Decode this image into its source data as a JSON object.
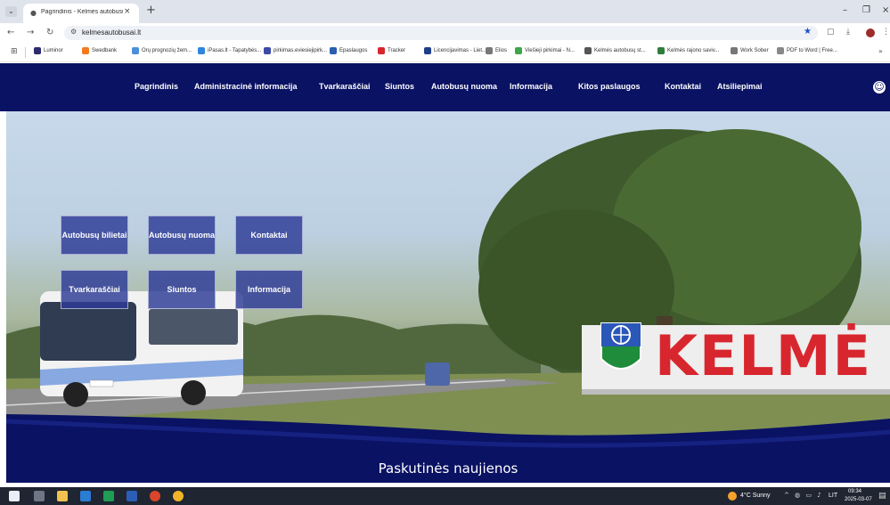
{
  "browser": {
    "tab_title": "Pagrindinis - Kelmės autobusų",
    "url": "kelmesautobusai.lt",
    "bookmarks": [
      {
        "label": "Luminor",
        "color": "#2b2b6e"
      },
      {
        "label": "Swedbank",
        "color": "#f47b20"
      },
      {
        "label": "Orų prognozių žem...",
        "color": "#4a8fd8"
      },
      {
        "label": "iPasas.lt - Tapatybės...",
        "color": "#2e86de"
      },
      {
        "label": "pirkimas.eviesiejipirk...",
        "color": "#3b4aa8"
      },
      {
        "label": "Epaslaugos",
        "color": "#2a5fb0"
      },
      {
        "label": "Tracker",
        "color": "#d8262e"
      },
      {
        "label": "Licencijavimas - Liet...",
        "color": "#1c3f8a"
      },
      {
        "label": "Elios",
        "color": "#777777"
      },
      {
        "label": "Viešieji pirkimai - N...",
        "color": "#3da64a"
      },
      {
        "label": "Kelmės autobusų st...",
        "color": "#555555"
      },
      {
        "label": "Kelmės rajono saviv...",
        "color": "#2f7d3a"
      },
      {
        "label": "Work Sober",
        "color": "#777777"
      },
      {
        "label": "PDF to Word | Free...",
        "color": "#888888"
      }
    ]
  },
  "site": {
    "nav": [
      "Pagrindinis",
      "Administracinė informacija",
      "Tvarkaraščiai",
      "Siuntos",
      "Autobusų nuoma",
      "Informacija",
      "Kitos paslaugos",
      "Kontaktai",
      "Atsiliepimai"
    ],
    "tiles": [
      "Autobusų bilietai",
      "Autobusų nuoma",
      "Kontaktai",
      "Tvarkaraščiai",
      "Siuntos",
      "Informacija"
    ],
    "hero_sign_text": "KELMĖ",
    "news_title": "Paskutinės naujienos"
  },
  "taskbar": {
    "weather": "4°C Sunny",
    "lang": "LIT",
    "time": "09:34",
    "date": "2025-03-07"
  },
  "colors": {
    "nav_bg": "#0a1263",
    "tile_bg": "#2d3a96",
    "sign_red": "#d8262e"
  }
}
